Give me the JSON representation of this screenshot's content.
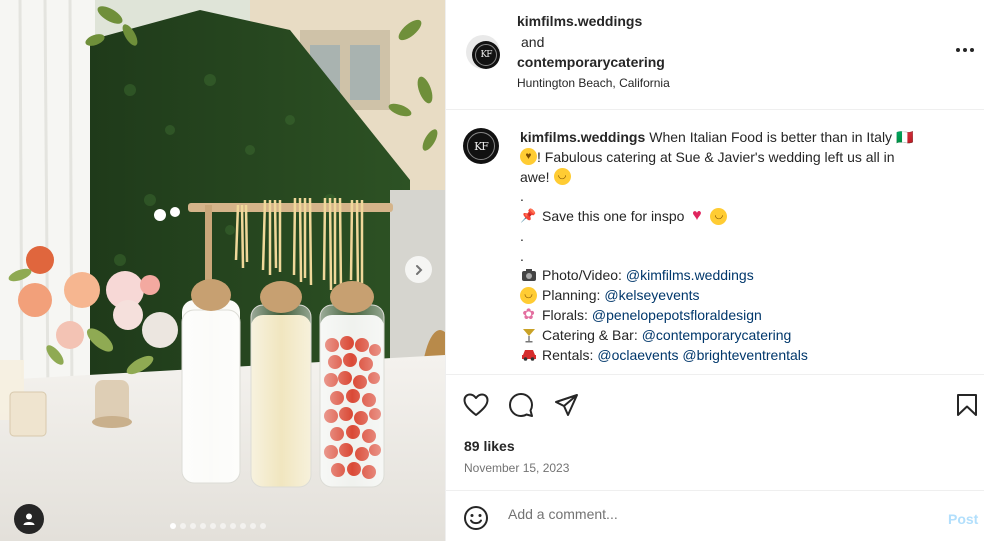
{
  "media": {
    "carousel_count": 10,
    "active_index": 0
  },
  "header": {
    "user1": "kimfilms.weddings",
    "and_text": "and",
    "user2": "contemporarycatering",
    "location": "Huntington Beach, California",
    "avatar_initials": "KF"
  },
  "caption": {
    "username": "kimfilms.weddings",
    "line1_text": "When Italian Food is better than in Italy 🇮🇹",
    "line2_text": "! Fabulous catering at Sue & Javier's wedding left us all in",
    "line3_text": "awe!",
    "dot1": ".",
    "save_text": "Save this one for inspo",
    "dot2": ".",
    "dot3": ".",
    "credits": [
      {
        "icon": "camera-icon",
        "label": "Photo/Video:",
        "handles": "@kimfilms.weddings"
      },
      {
        "icon": "face-icon",
        "label": "Planning:",
        "handles": "@kelseyevents"
      },
      {
        "icon": "flower-icon",
        "label": "Florals:",
        "handles": "@penelopepotsfloraldesign"
      },
      {
        "icon": "cocktail-icon",
        "label": "Catering & Bar:",
        "handles": "@contemporarycatering"
      },
      {
        "icon": "car-icon",
        "label": "Rentals:",
        "handles": "@oclaevents @brighteventrentals"
      }
    ]
  },
  "actions": {
    "likes": "89 likes",
    "date": "November 15, 2023"
  },
  "comment": {
    "placeholder": "Add a comment...",
    "post_label": "Post"
  },
  "colors": {
    "link": "#00376b",
    "post_disabled": "#b2dffc",
    "muted": "#737373"
  }
}
